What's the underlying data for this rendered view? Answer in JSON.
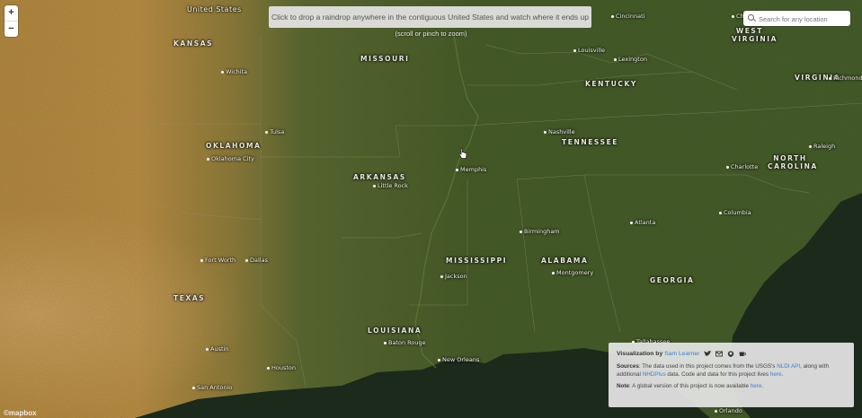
{
  "zoom": {
    "in_label": "+",
    "out_label": "−"
  },
  "instruction": "Click to drop a raindrop anywhere in the contiguous United States and watch where it ends up",
  "hint": "(scroll or pinch to zoom)",
  "search": {
    "placeholder": "Search for any location"
  },
  "info": {
    "credit_prefix": "Visualization by",
    "author": "Sam Learner",
    "icons": [
      "twitter-icon",
      "mail-icon",
      "github-icon",
      "coffee-icon"
    ],
    "sources_label": "Sources",
    "sources_text_1": ": The data used in this project comes from the USGS's ",
    "sources_link_1": "NLDI API",
    "sources_text_2": ", along with additional ",
    "sources_link_2": "NHDPlus",
    "sources_text_3": " data. Code and data for this project lives ",
    "sources_link_3": "here",
    "sources_text_4": ".",
    "note_label": "Note",
    "note_text": ": A global version of this project is now available ",
    "note_link": "here",
    "note_end": "."
  },
  "logo": "©mapbox",
  "map": {
    "states": [
      {
        "name": "KANSAS"
      },
      {
        "name": "MISSOURI"
      },
      {
        "name": "KENTUCKY"
      },
      {
        "name": "TENNESSEE"
      },
      {
        "name": "OKLAHOMA"
      },
      {
        "name": "ARKANSAS"
      },
      {
        "name": "MISSISSIPPI"
      },
      {
        "name": "ALABAMA"
      },
      {
        "name": "GEORGIA"
      },
      {
        "name": "TEXAS"
      },
      {
        "name": "LOUISIANA"
      },
      {
        "name": "NORTH CAROLINA"
      },
      {
        "name": "VIRGINIA"
      },
      {
        "name": "WEST VIRGINIA"
      }
    ],
    "cities": [
      "Wichita",
      "Tulsa",
      "Oklahoma City",
      "Little Rock",
      "Memphis",
      "Nashville",
      "Louisville",
      "Lexington",
      "Cincinnati",
      "Charleston",
      "Richmond",
      "Raleigh",
      "Charlotte",
      "Columbia",
      "Atlanta",
      "Birmingham",
      "Montgomery",
      "Jackson",
      "Fort Worth",
      "Dallas",
      "Austin",
      "Houston",
      "San Antonio",
      "Baton Rouge",
      "New Orleans",
      "Tallahassee",
      "Orlando"
    ],
    "country": "United States",
    "colors": {
      "plains_tan": "#b98a3e",
      "forest_green": "#3f5a22",
      "water": "#1f2c1d"
    }
  }
}
